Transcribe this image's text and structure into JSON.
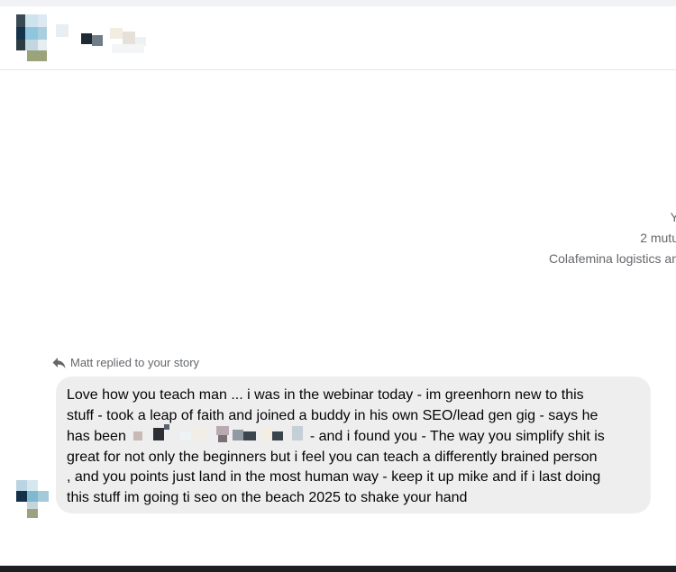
{
  "conversation": {
    "header_name": "",
    "profile_preview": {
      "name_fragment": "Y",
      "mutual_friends": "2 mutu",
      "work": "Colafemina logistics an"
    },
    "reply_context": {
      "icon": "reply-arrow-icon",
      "text": "Matt replied to your story"
    },
    "message": {
      "line1": "Love how you teach man ... i was in the webinar today - im greenhorn new to this",
      "line2": "stuff - took a leap of faith and joined a buddy in his own SEO/lead gen gig - says he",
      "line3_before": "has been",
      "line3_after": "-  and i found you -   The way you simplify shit is",
      "line4": "great for not only the beginners but i feel you can teach a differently brained person",
      "line5": ", and you points just land in the most human way - keep it up mike and if i last doing",
      "line6": "this stuff im going ti seo on the beach 2025 to shake your hand"
    }
  },
  "colors": {
    "bubble_background": "#eeeeee",
    "secondary_text": "#65676b",
    "bottom_bar": "#1c1e21"
  }
}
